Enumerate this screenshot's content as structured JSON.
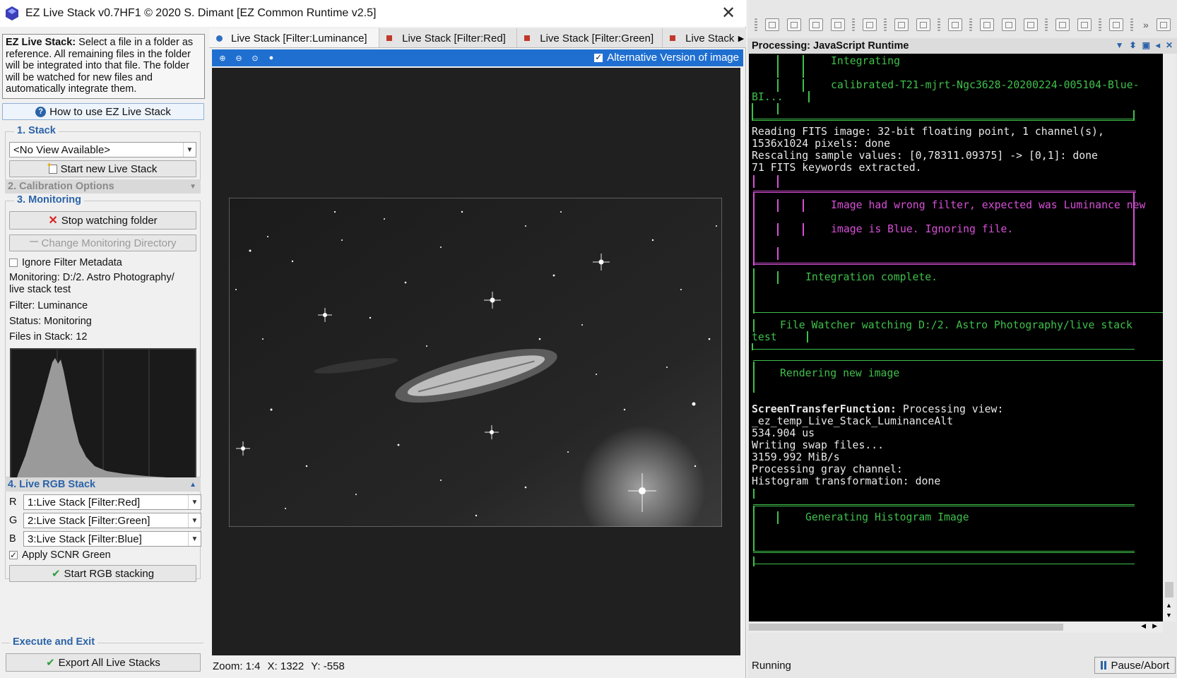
{
  "window": {
    "title": "EZ Live Stack v0.7HF1 © 2020 S. Dimant [EZ Common Runtime v2.5]",
    "close": "✕"
  },
  "sidebar": {
    "description_bold": "EZ Live Stack:",
    "description_text": "Select a file in a folder as reference. All remaining files in the folder will be integrated into that file. The folder will be watched for new files and automatically integrate them.",
    "howto_label": "How to use EZ Live Stack",
    "stack": {
      "title": "1. Stack",
      "view_value": "<No View Available>",
      "start_label": "Start new Live Stack"
    },
    "calibration": {
      "title": "2. Calibration Options"
    },
    "monitoring": {
      "title": "3. Monitoring",
      "stop_label": "Stop watching folder",
      "change_dir_label": "Change Monitoring Directory",
      "ignore_filter_label": "Ignore Filter Metadata",
      "monitoring_line1": "Monitoring: D:/2. Astro Photography/",
      "monitoring_line2": "live stack test",
      "filter_text": "Filter: Luminance",
      "status_text": "Status: Monitoring",
      "files_text": "Files in Stack: 12"
    },
    "rgb": {
      "title": "4. Live RGB Stack",
      "r_label": "R",
      "r_value": "1:Live Stack [Filter:Red]",
      "g_label": "G",
      "g_value": "2:Live Stack [Filter:Green]",
      "b_label": "B",
      "b_value": "3:Live Stack [Filter:Blue]",
      "scnr_label": "Apply SCNR Green",
      "scnr_checked": true,
      "start_rgb_label": "Start RGB stacking"
    },
    "execute": {
      "title": "Execute and Exit",
      "export_label": "Export All Live Stacks"
    }
  },
  "viewer": {
    "tabs": [
      {
        "label": "Live Stack [Filter:Luminance]",
        "active": true
      },
      {
        "label": "Live Stack [Filter:Red]",
        "active": false
      },
      {
        "label": "Live Stack [Filter:Green]",
        "active": false
      },
      {
        "label": "Live Stack",
        "active": false
      }
    ],
    "alt_version_label": "Alternative Version of image",
    "alt_version_checked": true,
    "zoom_text": "Zoom: 1:4",
    "x_text": "X: 1322",
    "y_text": "Y: -558"
  },
  "console_panel": {
    "title": "Processing: JavaScript Runtime",
    "lines": {
      "integrating": "Integrating",
      "calibrated_file": "calibrated-T21-mjrt-Ngc3628-20200224-005104-Blue-",
      "bi": "BI...",
      "reading": "Reading FITS image: 32-bit floating point, 1 channel(s),",
      "pixels": "1536x1024 pixels: done",
      "rescaling": "Rescaling sample values: [0,78311.09375] -> [0,1]: done",
      "keywords": "71 FITS keywords extracted.",
      "wrong_filter1": "Image had wrong filter, expected was Luminance new",
      "wrong_filter2": "image is Blue. Ignoring file.",
      "integration_complete": "Integration complete.",
      "file_watcher1": "File Watcher watching D:/2. Astro Photography/live stack",
      "file_watcher2": "test",
      "rendering": "Rendering new image",
      "stf_bold": "ScreenTransferFunction:",
      "stf_rest": " Processing view:",
      "stf_view": "_ez_temp_Live_Stack_LuminanceAlt",
      "us": "534.904 us",
      "swap": "Writing swap files...",
      "mibs": "3159.992 MiB/s",
      "gray": "Processing gray channel:",
      "histo_done": "Histogram transformation: done",
      "gen_histo": "Generating Histogram Image"
    }
  },
  "statusbar": {
    "status": "Running",
    "pause_label": "Pause/Abort"
  },
  "colors": {
    "accent": "#1f6fd1",
    "section_title": "#2b63a8",
    "console_green": "#3ec04a",
    "console_magenta": "#d84fd8"
  },
  "icons": [
    "app-icon",
    "close-icon",
    "help-icon",
    "new-stack-icon",
    "stop-icon",
    "folder-icon",
    "check-icon",
    "zoom-in-icon",
    "zoom-out-icon",
    "zoom-fit-icon",
    "zoom-1-icon",
    "pause-icon"
  ]
}
